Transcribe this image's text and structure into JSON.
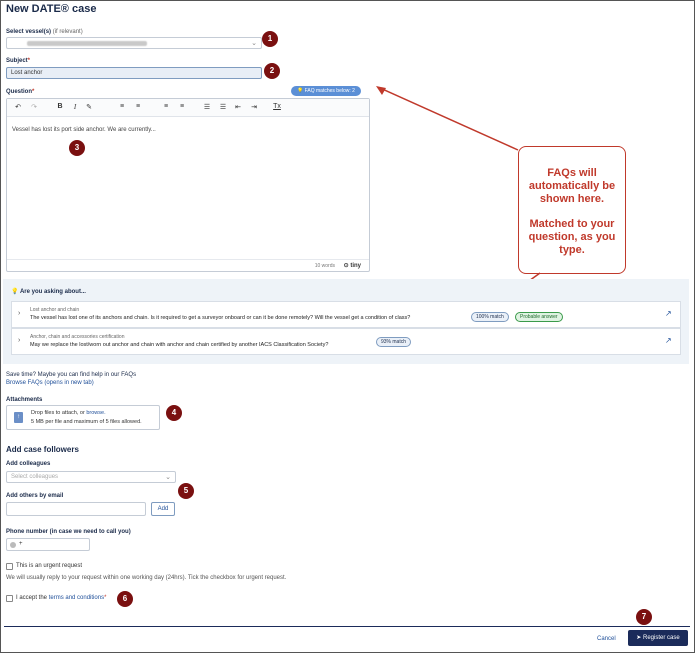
{
  "page": {
    "title": "New DATE® case"
  },
  "vessel": {
    "label": "Select vessel(s)",
    "hint": "(if relevant)"
  },
  "subject": {
    "label": "Subject",
    "required_mark": "*",
    "value": "Lost anchor"
  },
  "question": {
    "label": "Question",
    "required_mark": "*",
    "text": "Vessel has lost its port side anchor. We are currently...",
    "word_count": "10 words",
    "editor_brand": "tiny",
    "faq_badge": "FAQ matches below: 2"
  },
  "toolbar": {
    "undo": "↶",
    "redo": "↷",
    "bold": "B",
    "italic": "I",
    "highlight": "✎",
    "align_left": "≡",
    "align_center": "≡",
    "align_right": "≡",
    "justify": "≡",
    "bullet_list": "☰",
    "numbered_list": "☰",
    "outdent": "⇤",
    "indent": "⇥",
    "clear": "Tx"
  },
  "callout": {
    "text1": "FAQs will automatically be shown here.",
    "text2": "Matched to your question, as you type."
  },
  "faq": {
    "heading": "Are you asking about...",
    "items": [
      {
        "category": "Lost anchor and chain",
        "question": "The vessel has lost one of its anchors and chain. Is it required to get a surveyor onboard or can it be done remotely? Will the vessel get a condition of class?",
        "match": "100% match",
        "tag": "Probable answer"
      },
      {
        "category": "Anchor, chain and accessories certification",
        "question": "May we replace the lost/worn out anchor and chain with anchor and chain certified by another IACS Classification Society?",
        "match": "93% match",
        "tag": ""
      }
    ]
  },
  "save_time": {
    "text": "Save time? Maybe you can find help in our FAQs",
    "link": "Browse FAQs (opens in new tab)"
  },
  "attachments": {
    "label": "Attachments",
    "drop_text": "Drop files to attach, or",
    "browse": "browse.",
    "limits": "5 MB per file and maximum of 5 files allowed."
  },
  "followers": {
    "heading": "Add case followers",
    "colleagues_label": "Add colleagues",
    "colleagues_placeholder": "Select colleagues",
    "email_label": "Add others by email",
    "add_button": "Add"
  },
  "phone": {
    "label": "Phone number (in case we need to call you)",
    "prefix": "+"
  },
  "urgent": {
    "label": "This is an urgent request",
    "note": "We will usually reply to your request within one working day (24hrs). Tick the checkbox for urgent request."
  },
  "terms": {
    "prefix": "I accept the",
    "link": "terms and conditions",
    "required_mark": "*"
  },
  "actions": {
    "cancel": "Cancel",
    "register": "Register case"
  },
  "badges": [
    "1",
    "2",
    "3",
    "4",
    "5",
    "6",
    "7"
  ],
  "colors": {
    "accent": "#1b2b5a",
    "annotation": "#7a1010",
    "callout": "#c0392b"
  }
}
